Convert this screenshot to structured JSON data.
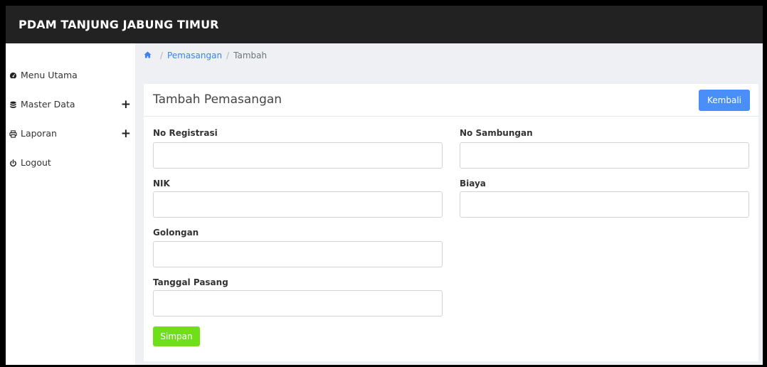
{
  "app": {
    "title": "PDAM TANJUNG JABUNG TIMUR"
  },
  "sidebar": {
    "items": [
      {
        "label": "Menu Utama",
        "icon": "dashboard-icon",
        "expandable": false
      },
      {
        "label": "Master Data",
        "icon": "database-icon",
        "expandable": true
      },
      {
        "label": "Laporan",
        "icon": "printer-icon",
        "expandable": true
      },
      {
        "label": "Logout",
        "icon": "power-icon",
        "expandable": false
      }
    ]
  },
  "breadcrumb": {
    "home_icon": "home-icon",
    "link": "Pemasangan",
    "current": "Tambah"
  },
  "card": {
    "title": "Tambah Pemasangan",
    "back_label": "Kembali"
  },
  "form": {
    "no_registrasi": {
      "label": "No Registrasi",
      "value": ""
    },
    "no_sambungan": {
      "label": "No Sambungan",
      "value": ""
    },
    "nik": {
      "label": "NIK",
      "value": ""
    },
    "biaya": {
      "label": "Biaya",
      "value": ""
    },
    "golongan": {
      "label": "Golongan",
      "value": ""
    },
    "tanggal_pasang": {
      "label": "Tanggal Pasang",
      "value": ""
    },
    "save_label": "Simpan"
  },
  "colors": {
    "topbar": "#222222",
    "primary": "#4a8ff7",
    "save": "#6fe017",
    "content_bg": "#eef0f3"
  }
}
